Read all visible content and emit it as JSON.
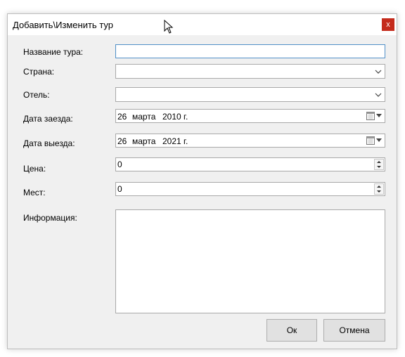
{
  "window": {
    "title": "Добавить\\Изменить тур",
    "close_glyph": "x"
  },
  "form": {
    "tour_name": {
      "label": "Название тура:",
      "value": ""
    },
    "country": {
      "label": "Страна:",
      "value": ""
    },
    "hotel": {
      "label": "Отель:",
      "value": ""
    },
    "arrival_date": {
      "label": "Дата заезда:",
      "day": "26",
      "month": "марта",
      "year": "2010 г."
    },
    "departure_date": {
      "label": "Дата выезда:",
      "day": "26",
      "month": "марта",
      "year": "2021 г."
    },
    "price": {
      "label": "Цена:",
      "value": "0"
    },
    "seats": {
      "label": "Мест:",
      "value": "0"
    },
    "info": {
      "label": "Информация:",
      "value": ""
    }
  },
  "buttons": {
    "ok": "Ок",
    "cancel": "Отмена"
  },
  "colors": {
    "close_button": "#c42b1c",
    "focus_border": "#4f8fc7",
    "window_bg": "#f0f0f0"
  },
  "icons": [
    "close-icon",
    "chevron-down-icon",
    "calendar-icon",
    "spin-up-icon",
    "spin-down-icon",
    "mouse-cursor-icon"
  ]
}
